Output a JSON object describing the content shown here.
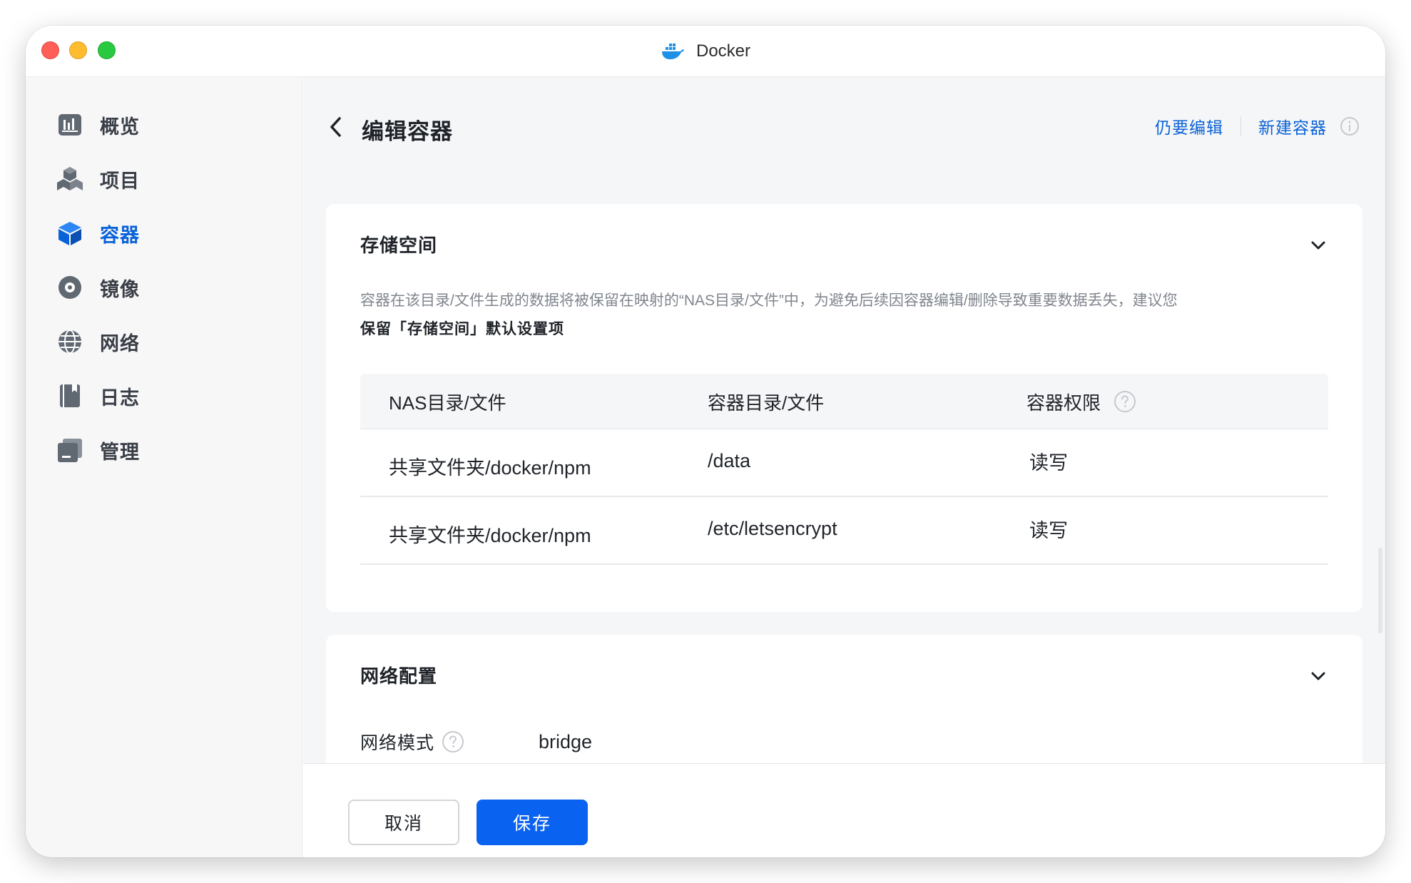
{
  "window": {
    "title": "Docker"
  },
  "sidebar": {
    "items": [
      {
        "label": "概览",
        "icon": "overview-chart-icon",
        "active": false
      },
      {
        "label": "项目",
        "icon": "project-cubes-icon",
        "active": false
      },
      {
        "label": "容器",
        "icon": "container-cube-icon",
        "active": true
      },
      {
        "label": "镜像",
        "icon": "image-disc-icon",
        "active": false
      },
      {
        "label": "网络",
        "icon": "network-globe-icon",
        "active": false
      },
      {
        "label": "日志",
        "icon": "log-book-icon",
        "active": false
      },
      {
        "label": "管理",
        "icon": "management-icon",
        "active": false
      }
    ]
  },
  "header": {
    "title": "编辑容器",
    "actions": {
      "edit_anyway": "仍要编辑",
      "new_container": "新建容器"
    }
  },
  "storage": {
    "title": "存储空间",
    "description": "容器在该目录/文件生成的数据将被保留在映射的“NAS目录/文件”中，为避免后续因容器编辑/删除导致重要数据丢失，建议您",
    "description_strong": "保留「存储空间」默认设置项",
    "table": {
      "headers": [
        "NAS目录/文件",
        "容器目录/文件",
        "容器权限"
      ],
      "rows": [
        [
          "共享文件夹/docker/npm",
          "/data",
          "读写"
        ],
        [
          "共享文件夹/docker/npm",
          "/etc/letsencrypt",
          "读写"
        ]
      ]
    }
  },
  "network": {
    "title": "网络配置",
    "mode_label": "网络模式",
    "mode_value": "bridge"
  },
  "footer": {
    "cancel": "取消",
    "save": "保存"
  },
  "colors": {
    "accent": "#0a62f0",
    "link": "#0a62d8",
    "active_nav": "#0a62d8"
  }
}
